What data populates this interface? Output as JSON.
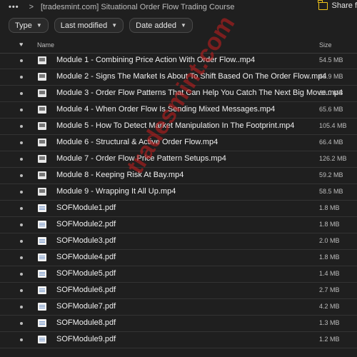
{
  "topbar": {
    "dots": "•••",
    "chevron": ">",
    "breadcrumb": "[tradesmint.com] Situational Order Flow Trading Course",
    "share_label": "Share f"
  },
  "filters": [
    {
      "label": "Type"
    },
    {
      "label": "Last modified"
    },
    {
      "label": "Date added"
    }
  ],
  "header": {
    "favorite_icon": "♥",
    "name_label": "Name",
    "size_label": "Size"
  },
  "files": [
    {
      "name": "Module 1 - Combining Price Action With Order Flow..mp4",
      "size": "54.5 MB",
      "type": "video"
    },
    {
      "name": "Module 2 - Signs The Market Is About To Shift Based On The Order Flow.mp4",
      "size": "63.9 MB",
      "type": "video"
    },
    {
      "name": "Module 3 - Order Flow Patterns That Can Help You Catch The Next Big Move.mp4",
      "size": "60.0 MB",
      "type": "video"
    },
    {
      "name": "Module 4 - When Order Flow Is Sending Mixed Messages.mp4",
      "size": "65.6 MB",
      "type": "video"
    },
    {
      "name": "Module 5 - How To Detect Market Manipulation In The Footprint.mp4",
      "size": "105.4 MB",
      "type": "video"
    },
    {
      "name": "Module 6 - Structural & Active Order Flow.mp4",
      "size": "66.4 MB",
      "type": "video"
    },
    {
      "name": "Module 7 - Order Flow Price Pattern Setups.mp4",
      "size": "126.2 MB",
      "type": "video"
    },
    {
      "name": "Module 8 - Keeping Risk At Bay.mp4",
      "size": "59.2 MB",
      "type": "video"
    },
    {
      "name": "Module 9 - Wrapping It All Up.mp4",
      "size": "58.5 MB",
      "type": "video"
    },
    {
      "name": "SOFModule1.pdf",
      "size": "1.8 MB",
      "type": "pdf"
    },
    {
      "name": "SOFModule2.pdf",
      "size": "1.8 MB",
      "type": "pdf"
    },
    {
      "name": "SOFModule3.pdf",
      "size": "2.0 MB",
      "type": "pdf"
    },
    {
      "name": "SOFModule4.pdf",
      "size": "1.8 MB",
      "type": "pdf"
    },
    {
      "name": "SOFModule5.pdf",
      "size": "1.4 MB",
      "type": "pdf"
    },
    {
      "name": "SOFModule6.pdf",
      "size": "2.7 MB",
      "type": "pdf"
    },
    {
      "name": "SOFModule7.pdf",
      "size": "4.2 MB",
      "type": "pdf"
    },
    {
      "name": "SOFModule8.pdf",
      "size": "1.3 MB",
      "type": "pdf"
    },
    {
      "name": "SOFModule9.pdf",
      "size": "1.2 MB",
      "type": "pdf"
    }
  ],
  "watermark": "tradesmint.com",
  "colors": {
    "background": "#1f1f1f",
    "accent_folder": "#f0c419",
    "watermark": "#c81e1e"
  }
}
